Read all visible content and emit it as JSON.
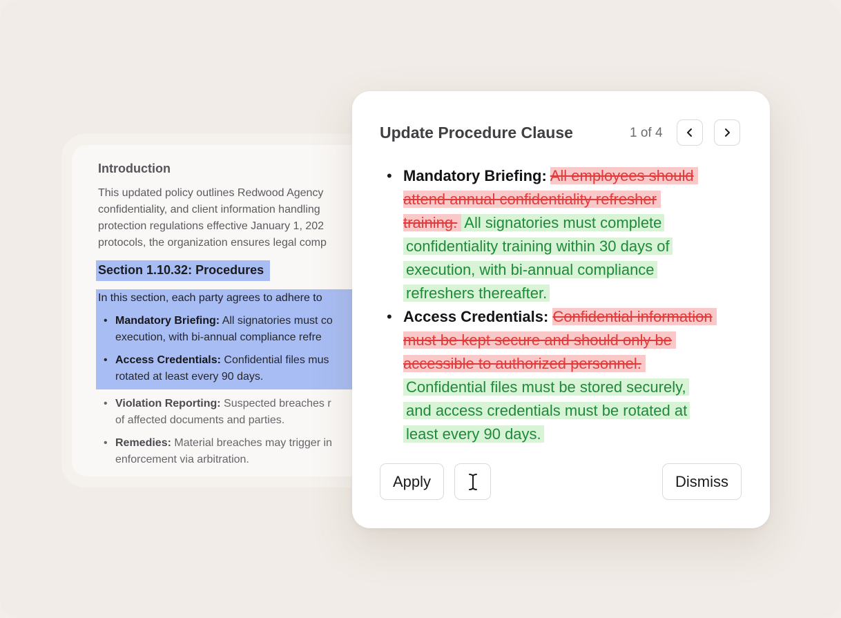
{
  "document": {
    "heading": "Introduction",
    "intro_lines": [
      "This updated policy outlines Redwood Agency",
      "confidentiality, and client information handling",
      "protection regulations effective January 1, 202",
      "protocols, the organization ensures legal comp"
    ],
    "section_title": "Section 1.10.32: Procedures",
    "section_intro": "In this section, each party agrees to adhere to",
    "items": [
      {
        "label": "Mandatory Briefing:",
        "lines": [
          "All signatories must co",
          "execution, with bi-annual compliance refre"
        ]
      },
      {
        "label": "Access Credentials:",
        "lines": [
          "Confidential files mus",
          "rotated at least every 90 days."
        ]
      },
      {
        "label": "Violation Reporting:",
        "lines": [
          "Suspected breaches r",
          "of affected documents and parties."
        ]
      },
      {
        "label": "Remedies:",
        "lines": [
          "Material breaches may trigger in",
          "enforcement via arbitration."
        ]
      }
    ]
  },
  "panel": {
    "title": "Update Procedure Clause",
    "counter": "1 of 4",
    "changes": [
      {
        "label": "Mandatory Briefing:",
        "deleted_lines": [
          "All employees should",
          "attend annual confidentiality refresher",
          "training."
        ],
        "inserted_lines": [
          "All signatories must complete",
          "confidentiality training within 30 days of",
          "execution, with bi-annual compliance",
          "refreshers thereafter."
        ]
      },
      {
        "label": "Access Credentials:",
        "deleted_lines": [
          "Confidential information",
          "must be kept secure and should only be",
          "accessible to authorized personnel."
        ],
        "inserted_lines": [
          "Confidential files must be stored securely,",
          "and access credentials must be rotated at",
          "least every 90 days."
        ]
      }
    ],
    "apply_label": "Apply",
    "dismiss_label": "Dismiss"
  },
  "colors": {
    "selection": "#a8bdf4",
    "deleted_bg": "#f9c9c9",
    "deleted_text": "#e03a3a",
    "inserted_bg": "#d8f3d6",
    "inserted_text": "#1e8a3a"
  },
  "icons": {
    "prev": "chevron-left-icon",
    "next": "chevron-right-icon",
    "cursor": "text-cursor-icon"
  }
}
